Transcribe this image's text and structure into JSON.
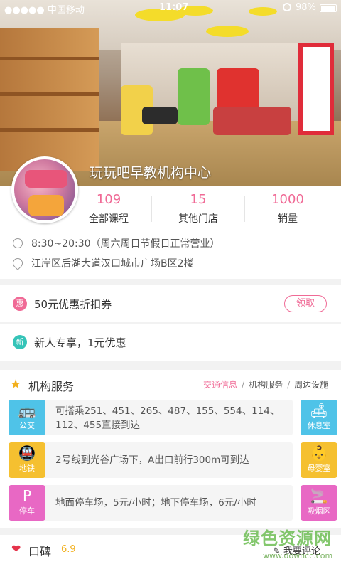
{
  "status_bar": {
    "carrier": "●●●●● 中国移动",
    "time": "11:07",
    "battery": "98%"
  },
  "header": {
    "title": "玩玩吧早教机构中心"
  },
  "stats": [
    {
      "value": "109",
      "label": "全部课程"
    },
    {
      "value": "15",
      "label": "其他门店"
    },
    {
      "value": "1000",
      "label": "销量"
    }
  ],
  "info": {
    "hours": "8:30~20:30（周六周日节假日正常营业）",
    "address": "江岸区后湖大道汉口城市广场B区2楼"
  },
  "coupon": {
    "badge": "惠",
    "text": "50元优惠折扣券",
    "button": "领取",
    "accent": "#f06a96"
  },
  "newcomer": {
    "badge": "新",
    "text": "新人专享，1元优惠",
    "accent": "#35c4b8"
  },
  "services": {
    "title": "机构服务",
    "tabs": [
      "交通信息",
      "机构服务",
      "周边设施"
    ],
    "rows": [
      {
        "icon": "bus-icon",
        "label": "公交",
        "text": "可搭乘251、451、265、487、155、554、114、112、455直接到达",
        "color": "#4fc3e8"
      },
      {
        "icon": "subway-icon",
        "label": "地铁",
        "text": "2号线到光谷广场下，A出口前行300m可到达",
        "color": "#f5c030"
      },
      {
        "icon": "parking-icon",
        "label": "停车",
        "text": "地面停车场，5元/小时；地下停车场，6元/小时",
        "color": "#e868c4"
      }
    ],
    "side": [
      {
        "icon": "sofa-icon",
        "label": "休息室",
        "color": "#4fc3e8"
      },
      {
        "icon": "stroller-icon",
        "label": "母婴室",
        "color": "#f5c030"
      },
      {
        "icon": "cigarette-icon",
        "label": "吸烟区",
        "color": "#e868c4"
      }
    ]
  },
  "review": {
    "title": "口碑",
    "score": "6.9",
    "write": "我要评论"
  },
  "watermark": {
    "main": "绿色资源网",
    "sub": "www.downcc.com"
  }
}
